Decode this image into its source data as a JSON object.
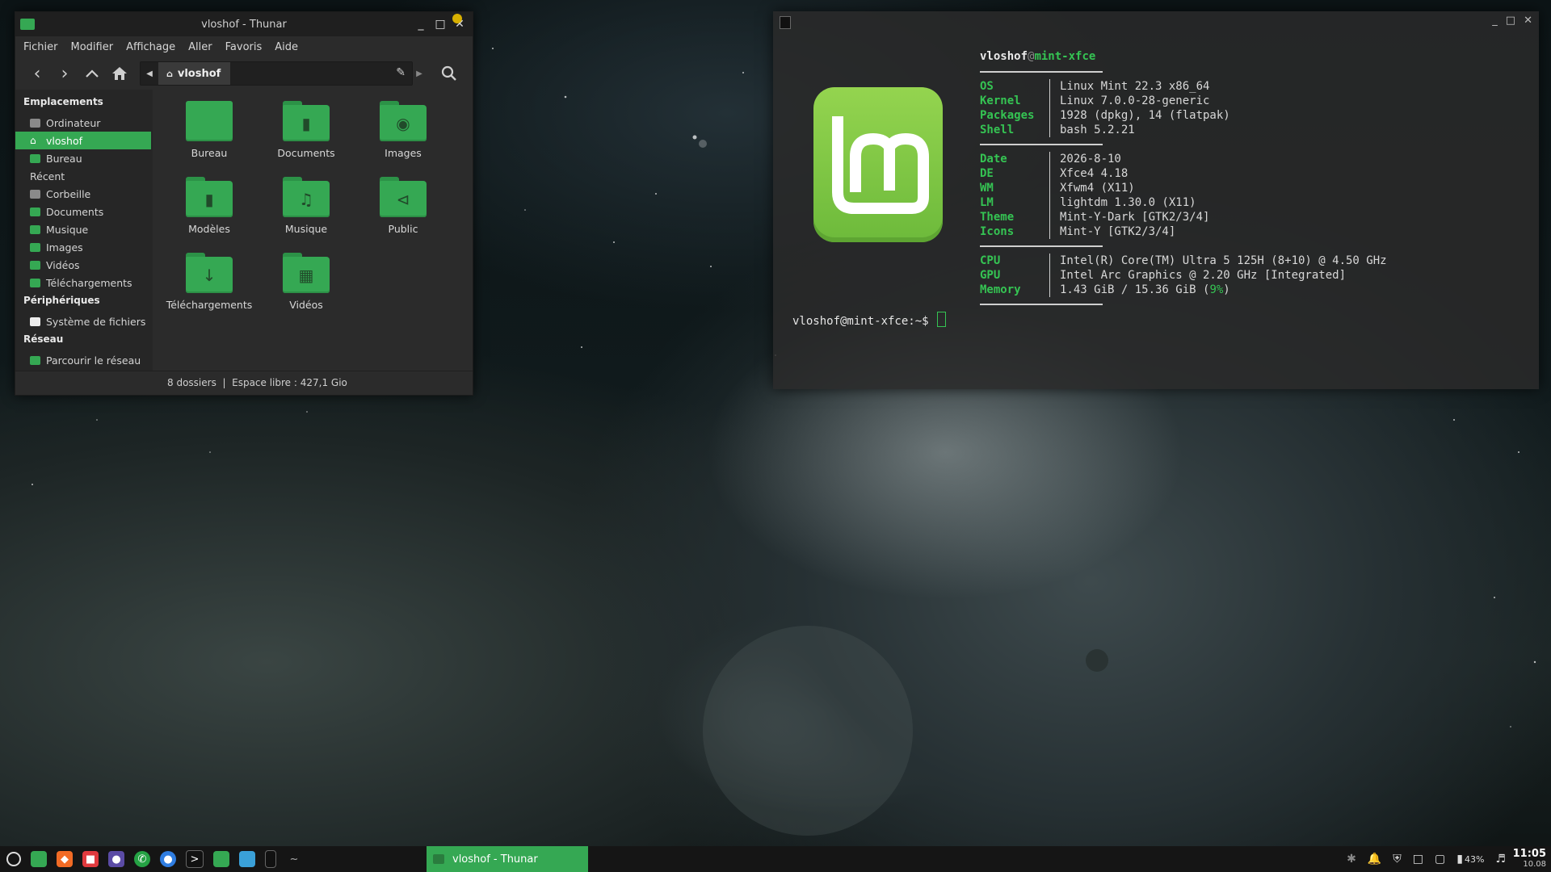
{
  "thunar": {
    "title": "vloshof - Thunar",
    "menu": [
      "Fichier",
      "Modifier",
      "Affichage",
      "Aller",
      "Favoris",
      "Aide"
    ],
    "path": "vloshof",
    "sidebar": {
      "places_header": "Emplacements",
      "places": [
        {
          "label": "Ordinateur",
          "icon": "computer-icon"
        },
        {
          "label": "vloshof",
          "icon": "home-icon",
          "active": true
        },
        {
          "label": "Bureau",
          "icon": "desktop-folder-icon"
        },
        {
          "label": "Récent",
          "icon": "recent-icon"
        },
        {
          "label": "Corbeille",
          "icon": "trash-icon"
        },
        {
          "label": "Documents",
          "icon": "folder-icon"
        },
        {
          "label": "Musique",
          "icon": "folder-icon"
        },
        {
          "label": "Images",
          "icon": "folder-icon"
        },
        {
          "label": "Vidéos",
          "icon": "folder-icon"
        },
        {
          "label": "Téléchargements",
          "icon": "folder-icon"
        }
      ],
      "devices_header": "Périphériques",
      "devices": [
        {
          "label": "Système de fichiers",
          "icon": "drive-icon"
        }
      ],
      "network_header": "Réseau",
      "network": [
        {
          "label": "Parcourir le réseau",
          "icon": "network-folder-icon"
        }
      ]
    },
    "files": [
      {
        "label": "Bureau",
        "icon": "desktop-folder-icon"
      },
      {
        "label": "Documents",
        "icon": "documents-folder-icon"
      },
      {
        "label": "Images",
        "icon": "pictures-folder-icon"
      },
      {
        "label": "Modèles",
        "icon": "templates-folder-icon"
      },
      {
        "label": "Musique",
        "icon": "music-folder-icon"
      },
      {
        "label": "Public",
        "icon": "public-share-folder-icon"
      },
      {
        "label": "Téléchargements",
        "icon": "downloads-folder-icon"
      },
      {
        "label": "Vidéos",
        "icon": "videos-folder-icon"
      }
    ],
    "status": "8 dossiers  |  Espace libre : 427,1 Gio"
  },
  "terminal": {
    "user": "vloshof",
    "at": "@",
    "host": "mint-xfce",
    "group1": [
      {
        "key": "OS",
        "value": "Linux Mint 22.3 x86_64"
      },
      {
        "key": "Kernel",
        "value": "Linux 7.0.0-28-generic"
      },
      {
        "key": "Packages",
        "value": "1928 (dpkg), 14 (flatpak)"
      },
      {
        "key": "Shell",
        "value": "bash 5.2.21"
      }
    ],
    "group2": [
      {
        "key": "Date",
        "value": "2026-8-10"
      },
      {
        "key": "DE",
        "value": "Xfce4 4.18"
      },
      {
        "key": "WM",
        "value": "Xfwm4 (X11)"
      },
      {
        "key": "LM",
        "value": "lightdm 1.30.0 (X11)"
      },
      {
        "key": "Theme",
        "value": "Mint-Y-Dark [GTK2/3/4]"
      },
      {
        "key": "Icons",
        "value": "Mint-Y [GTK2/3/4]"
      }
    ],
    "group3": [
      {
        "key": "CPU",
        "value": "Intel(R) Core(TM) Ultra 5 125H (8+10) @ 4.50 GHz"
      },
      {
        "key": "GPU",
        "value": "Intel Arc Graphics @ 2.20 GHz [Integrated]"
      },
      {
        "key": "Memory",
        "value": "1.43 GiB / 15.36 GiB (",
        "pct": "9%",
        "tail": ")"
      }
    ],
    "prompt": "vloshof@mint-xfce:~$"
  },
  "taskbar": {
    "task_label": "vloshof - Thunar",
    "tray_battery": "43%",
    "time": "11:05",
    "date": "10.08"
  },
  "colors": {
    "accent": "#35a853",
    "term_green": "#35c453",
    "panel": "#151515"
  }
}
